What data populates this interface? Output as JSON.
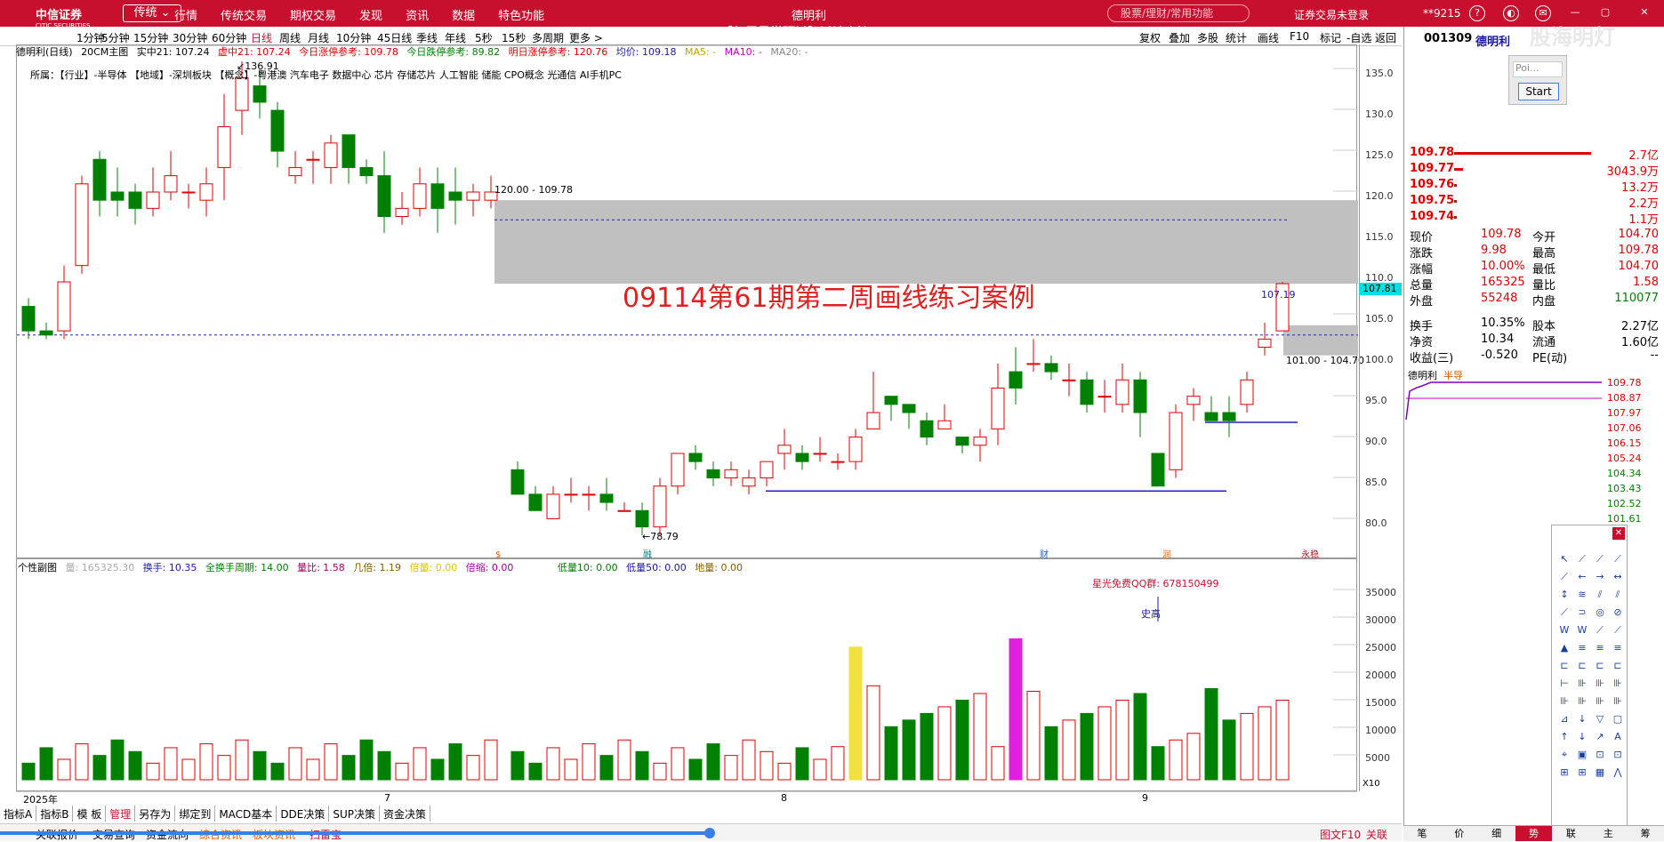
{
  "topbar": {
    "logo": "中信证券",
    "logo_sub": "CITIC SECURITIES",
    "mode": "传统 ⌄",
    "menu": [
      "行情",
      "传统交易",
      "期权交易",
      "发现",
      "资讯",
      "数据",
      "特色功能"
    ],
    "window_title": "德明利",
    "search_placeholder": "股票/理财/常用功能",
    "account": "证券交易未登录",
    "user": "**9215",
    "video_title": "【每周量学研讨】讨论交流-250914.mp4"
  },
  "tabs": [
    "1分钟",
    "5分钟",
    "15分钟",
    "30分钟",
    "60分钟",
    "日线",
    "周线",
    "月线",
    "10分钟",
    "45日线",
    "季线",
    "年线",
    "5秒",
    "15秒",
    "多周期",
    "更多 >"
  ],
  "active_tab": "日线",
  "toolbar_right": [
    "复权",
    "叠加",
    "多股",
    "统计",
    "画线",
    "F10",
    "标记",
    "-自选",
    "返回"
  ],
  "chart_info": {
    "name": "德明利(日线)",
    "indicator": "20CM主图",
    "real": "实中21: 107.24",
    "virtual": "虚中21: 107.24",
    "limit_up_today": "今日涨停参考: 109.78",
    "limit_down_today": "今日跌停参考: 89.82",
    "limit_up_tomorrow": "明日涨停参考: 120.76",
    "avg": "均价: 109.18",
    "ma5": "MA5: -",
    "ma10": "MA10: -",
    "ma20": "MA20: -"
  },
  "belong": "所属：【行业】-半导体 【地域】-深圳板块 【概念】-粤港澳 汽车电子 数据中心 芯片 存储芯片 人工智能 储能 CPO概念 光通信 AI手机PC",
  "annotation": "09114第61期第二周画线练习案例",
  "labels": {
    "high": "136.91",
    "low": "78.79",
    "zone1": "120.00 - 109.78",
    "zone2": "101.00 - 104.70",
    "mark_price": "107.19",
    "cursor_price": "107.81"
  },
  "price_axis": [
    "135.0",
    "130.0",
    "125.0",
    "120.0",
    "115.0",
    "110.0",
    "105.0",
    "100.0",
    "95.0",
    "90.0",
    "85.0",
    "80.0"
  ],
  "sub_info": {
    "title": "个性副图",
    "vol": "量: 165325.30",
    "turnover": "换手: 10.35",
    "full_turnover": "全换手周期: 14.00",
    "vol_ratio": "量比: 1.58",
    "times": "几倍: 1.19",
    "double": "倍量: 0.00",
    "double_shrink": "倍缩: 0.00",
    "low10": "低量10: 0.00",
    "low50": "低量50: 0.00",
    "ground": "地量: 0.00",
    "qq": "星光免费QQ群: 678150499",
    "shigao": "史高"
  },
  "sub_axis": [
    "35000",
    "30000",
    "25000",
    "20000",
    "15000",
    "10000",
    "5000"
  ],
  "sub_axis_mult": "X10",
  "dates": [
    "2025年",
    "7",
    "8",
    "9"
  ],
  "bottom_tabs": [
    "指标A",
    "指标B",
    "模 板",
    "管理",
    "另存为",
    "绑定到",
    "MACD基本",
    "DDE决策",
    "SUP决策",
    "资金决策"
  ],
  "status": [
    "关联报价",
    "交易查询",
    "资金流向",
    "综合资讯",
    "板块资讯",
    "扫雷宝"
  ],
  "status_right": [
    "图文F10",
    "关联"
  ],
  "right_panel": {
    "code": "001309",
    "name": "德明利",
    "popup_field": "Poi...",
    "popup_button": "Start",
    "orders": [
      {
        "price": "109.78",
        "amount": "2.7亿"
      },
      {
        "price": "109.77",
        "amount": "3043.9万"
      },
      {
        "price": "109.76",
        "amount": "13.2万"
      },
      {
        "price": "109.75",
        "amount": "2.2万"
      },
      {
        "price": "109.74",
        "amount": "1.1万"
      }
    ],
    "quote": [
      {
        "k1": "现价",
        "v1": "109.78",
        "k2": "今开",
        "v2": "104.70"
      },
      {
        "k1": "涨跌",
        "v1": "9.98",
        "k2": "最高",
        "v2": "109.78"
      },
      {
        "k1": "涨幅",
        "v1": "10.00%",
        "k2": "最低",
        "v2": "104.70"
      },
      {
        "k1": "总量",
        "v1": "165325",
        "k2": "量比",
        "v2": "1.58"
      },
      {
        "k1": "外盘",
        "v1": "55248",
        "k2": "内盘",
        "v2": "110077"
      }
    ],
    "quote2": [
      {
        "k1": "换手",
        "v1": "10.35%",
        "k2": "股本",
        "v2": "2.27亿"
      },
      {
        "k1": "净资",
        "v1": "10.34",
        "k2": "流通",
        "v2": "1.60亿"
      },
      {
        "k1": "收益(三)",
        "v1": "-0.520",
        "k2": "PE(动)",
        "v2": "--"
      }
    ],
    "mini_title": "德明利",
    "mini_tag": "半导",
    "mini_axis": [
      "109.78",
      "108.87",
      "107.97",
      "107.06",
      "106.15",
      "105.24",
      "104.34",
      "103.43",
      "102.52",
      "101.61",
      "100.70"
    ],
    "bottom": [
      "笔",
      "价",
      "细",
      "势",
      "联",
      "主",
      "筹"
    ]
  },
  "overlay_watermark": "股海明灯",
  "colors": {
    "up": "#e00000",
    "down": "#008000",
    "brand": "#c8102e"
  }
}
